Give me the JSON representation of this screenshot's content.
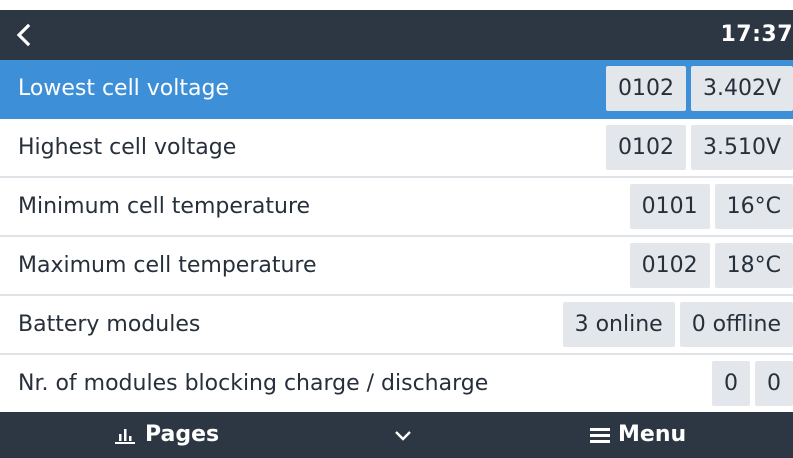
{
  "header": {
    "time": "17:37"
  },
  "rows": [
    {
      "label": "Lowest cell voltage",
      "values": [
        "0102",
        "3.402V"
      ]
    },
    {
      "label": "Highest cell voltage",
      "values": [
        "0102",
        "3.510V"
      ]
    },
    {
      "label": "Minimum cell temperature",
      "values": [
        "0101",
        "16°C"
      ]
    },
    {
      "label": "Maximum cell temperature",
      "values": [
        "0102",
        "18°C"
      ]
    },
    {
      "label": "Battery modules",
      "values": [
        "3 online",
        "0 offline"
      ]
    },
    {
      "label": "Nr. of modules blocking charge / discharge",
      "values": [
        "0",
        "0"
      ]
    }
  ],
  "footer": {
    "pages_label": "Pages",
    "menu_label": "Menu"
  },
  "icons": {
    "back": "chevron-left-icon",
    "pages": "bar-chart-icon",
    "expand": "chevron-down-icon",
    "menu": "hamburger-menu-icon"
  },
  "colors": {
    "header_bg": "#2c3743",
    "selected_row_bg": "#3d8fd8",
    "value_box_bg": "#e3e6ea"
  }
}
